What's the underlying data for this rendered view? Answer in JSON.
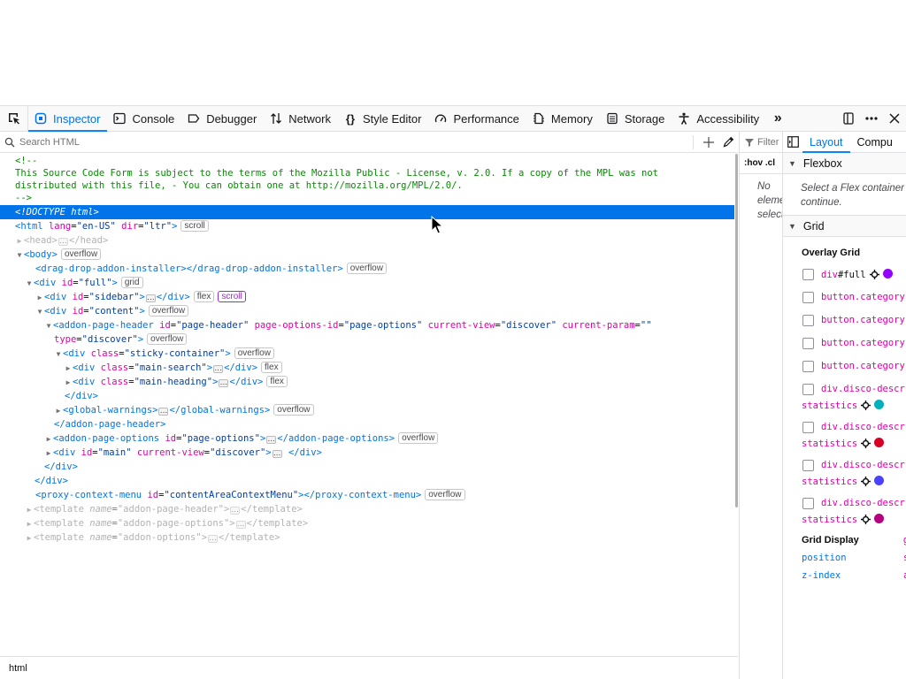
{
  "toolbar": {
    "tabs": [
      {
        "label": "Inspector",
        "icon": "inspector-icon"
      },
      {
        "label": "Console",
        "icon": "console-icon"
      },
      {
        "label": "Debugger",
        "icon": "debugger-icon"
      },
      {
        "label": "Network",
        "icon": "network-icon"
      },
      {
        "label": "Style Editor",
        "icon": "style-editor-icon"
      },
      {
        "label": "Performance",
        "icon": "performance-icon"
      },
      {
        "label": "Memory",
        "icon": "memory-icon"
      },
      {
        "label": "Storage",
        "icon": "storage-icon"
      },
      {
        "label": "Accessibility",
        "icon": "accessibility-icon"
      }
    ],
    "active_tab": "Inspector",
    "overflow_label": "»"
  },
  "search": {
    "placeholder": "Search HTML"
  },
  "markup": {
    "comment_open": "<!--",
    "comment_line1": "This Source Code Form is subject to the terms of the Mozilla Public - License, v. 2.0. If a copy of the MPL was not",
    "comment_line2": "distributed with this file, - You can obtain one at http://mozilla.org/MPL/2.0/.",
    "comment_close": "-->",
    "doctype": "<!DOCTYPE html>",
    "html_tag": "html",
    "html_lang_attr": "lang",
    "html_lang_val": "\"en-US\"",
    "html_dir_attr": "dir",
    "html_dir_val": "\"ltr\"",
    "badge_scroll": "scroll",
    "badge_overflow": "overflow",
    "badge_grid": "grid",
    "badge_flex": "flex",
    "head_tag": "head",
    "body_tag": "body",
    "dda_tag": "drag-drop-addon-installer",
    "div_tag": "div",
    "id_attr": "id",
    "class_attr": "class",
    "full_val": "\"full\"",
    "sidebar_val": "\"sidebar\"",
    "content_val": "\"content\"",
    "aph_tag": "addon-page-header",
    "page_header_val": "\"page-header\"",
    "page_options_id_attr": "page-options-id",
    "page_options_val": "\"page-options\"",
    "current_view_attr": "current-view",
    "discover_val": "\"discover\"",
    "current_param_attr": "current-param",
    "empty_val": "\"\"",
    "type_attr": "type",
    "sticky_val": "\"sticky-container\"",
    "main_search_val": "\"main-search\"",
    "main_heading_val": "\"main-heading\"",
    "gw_tag": "global-warnings",
    "apo_tag": "addon-page-options",
    "main_val": "\"main\"",
    "pcm_tag": "proxy-context-menu",
    "pcm_id_val": "\"contentAreaContextMenu\"",
    "template_tag": "template",
    "name_attr": "name",
    "tpl_header_val": "\"addon-page-header\"",
    "tpl_options_val": "\"addon-page-options\"",
    "tpl_addon_options_val": "\"addon-options\""
  },
  "breadcrumb": {
    "item": "html"
  },
  "rules": {
    "filter_placeholder": "Filter",
    "pseudo_hov": ":hov",
    "pseudo_cls": ".cl",
    "no_element_1": "No",
    "no_element_2": "eleme",
    "no_element_3": "select"
  },
  "layout": {
    "tabs": [
      "Layout",
      "Compu"
    ],
    "flexbox_title": "Flexbox",
    "flexbox_msg_1": "Select a Flex container",
    "flexbox_msg_2": "continue.",
    "grid_title": "Grid",
    "overlay_title": "Overlay Grid",
    "grid_items": [
      {
        "name": "div",
        "tail": "#full",
        "color": "#9400ff"
      },
      {
        "name": "button.category",
        "tail": ""
      },
      {
        "name": "button.category",
        "tail": ""
      },
      {
        "name": "button.category",
        "tail": ""
      },
      {
        "name": "button.category",
        "tail": ""
      }
    ],
    "grid_items_two": [
      {
        "name": "div.disco-descr",
        "sub": "statistics",
        "color": "#00b0bd"
      },
      {
        "name": "div.disco-descr",
        "sub": "statistics",
        "color": "#d70022"
      },
      {
        "name": "div.disco-descr",
        "sub": "statistics",
        "color": "#4b42ff"
      },
      {
        "name": "div.disco-descr",
        "sub": "statistics",
        "color": "#b5007f"
      }
    ],
    "grid_display_label": "Grid Display",
    "grid_display_value": "g",
    "props": [
      {
        "name": "position",
        "value": "s"
      },
      {
        "name": "z-index",
        "value": "a"
      }
    ]
  }
}
